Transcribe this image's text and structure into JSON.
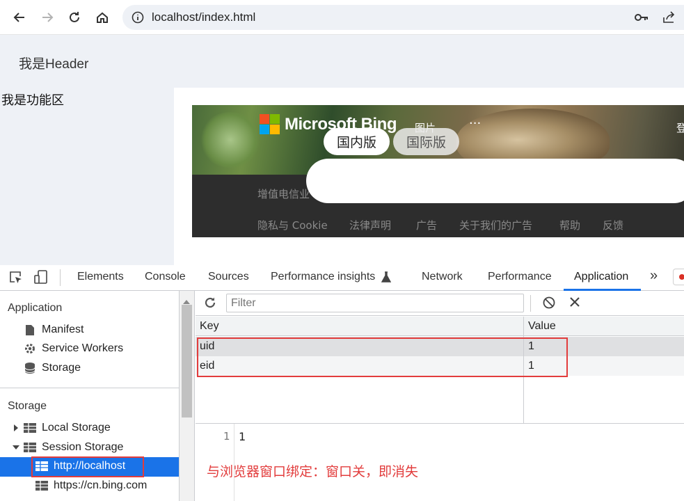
{
  "browser": {
    "address": "localhost/index.html",
    "icons": [
      "back-arrow-icon",
      "forward-arrow-icon",
      "reload-icon",
      "home-icon",
      "info-icon",
      "key-icon",
      "share-icon"
    ]
  },
  "page": {
    "header_text": "我是Header",
    "function_text": "我是功能区",
    "bing": {
      "brand": "Microsoft Bing",
      "nav_images": "图片",
      "nav_more": "···",
      "nav_login": "登",
      "domestic": "国内版",
      "international": "国际版",
      "icp_partial": "增值电信业",
      "footer_links": [
        "隐私与 Cookie",
        "法律声明",
        "广告",
        "关于我们的广告",
        "帮助",
        "反馈"
      ]
    }
  },
  "devtools": {
    "tabs": [
      "Elements",
      "Console",
      "Sources",
      "Performance insights",
      "Network",
      "Performance",
      "Application"
    ],
    "active_tab": "Application",
    "more_tabs_glyph": "»",
    "sidebar": {
      "application_header": "Application",
      "application_items": [
        "Manifest",
        "Service Workers",
        "Storage"
      ],
      "storage_header": "Storage",
      "local_storage": "Local Storage",
      "session_storage": "Session Storage",
      "session_children": [
        "http://localhost",
        "https://cn.bing.com"
      ]
    },
    "filter_placeholder": "Filter",
    "table": {
      "columns": [
        "Key",
        "Value"
      ],
      "rows": [
        {
          "key": "uid",
          "value": "1"
        },
        {
          "key": "eid",
          "value": "1"
        }
      ]
    },
    "preview": {
      "line_number": "1",
      "content": "1"
    },
    "annotation": "与浏览器窗口绑定：窗口关，即消失"
  },
  "colors": {
    "accent": "#1a73e8",
    "highlight": "#e23c3c",
    "page_bg": "#eef1f6"
  }
}
